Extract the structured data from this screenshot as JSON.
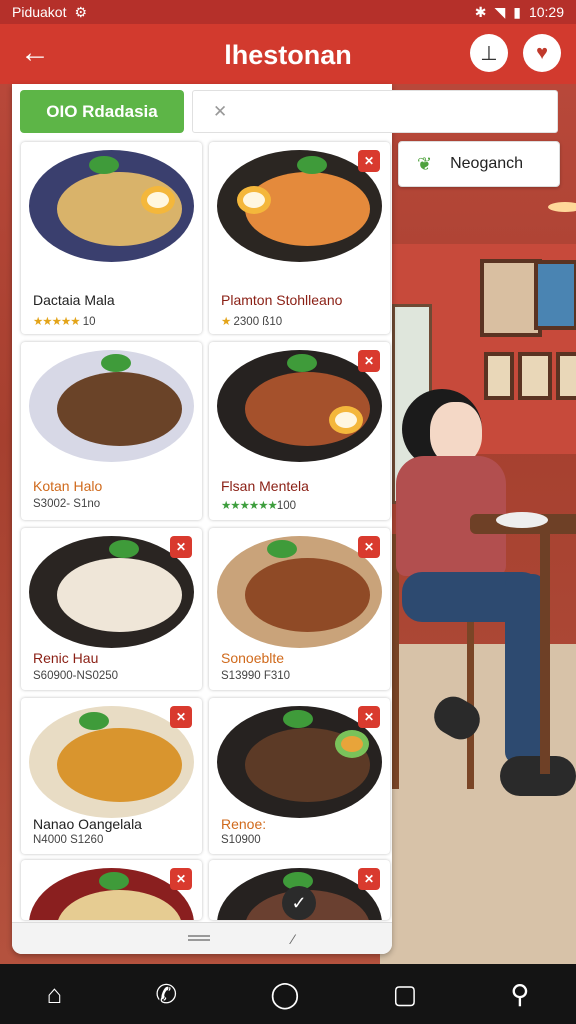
{
  "statusbar": {
    "carrier": "Piduakot",
    "time": "10:29",
    "left_icon": "settings-icon",
    "right_icons": [
      "bluetooth-icon",
      "wifi-icon",
      "battery-icon"
    ]
  },
  "appbar": {
    "title": "lhestonan",
    "back_icon": "arrow-left-icon",
    "action_icons": [
      "info-icon",
      "heart-icon"
    ]
  },
  "search": {
    "chip_label": "OIO Rdadasia",
    "placeholder": ""
  },
  "filter": {
    "label": "Neoganch",
    "icon": "leaf-icon"
  },
  "cards": [
    {
      "name": "Dactaia Mala",
      "stars": "★★★★★",
      "sub": "10",
      "fav": false
    },
    {
      "name": "Plamton Stohlleano",
      "stars": "★",
      "sub": "2300 ß10",
      "fav": true
    },
    {
      "name": "Kotan Halo",
      "stars": "",
      "sub": "S3002- S1no",
      "fav": false
    },
    {
      "name": "Flsan Mentela",
      "stars": "★★★★★★",
      "sub": "100",
      "fav": true
    },
    {
      "name": "Renic Hau",
      "stars": "",
      "sub": "S60900-NS0250",
      "fav": true
    },
    {
      "name": "Sonoeblte",
      "stars": "",
      "sub": "S13990 F310",
      "fav": true
    },
    {
      "name": "Nanao Oangelala",
      "stars": "",
      "sub": "N4000 S1260",
      "fav": true
    },
    {
      "name": "Renoe:",
      "stars": "",
      "sub": "S10900",
      "fav": true
    },
    {
      "name": "",
      "stars": "",
      "sub": "",
      "fav": true
    },
    {
      "name": "",
      "stars": "",
      "sub": "",
      "fav": true
    }
  ],
  "fav_glyph": "✕",
  "navbar": [
    "home-icon",
    "phone-icon",
    "circle-icon",
    "square-icon",
    "profile-icon"
  ],
  "colors": {
    "brand": "#d23a2e",
    "accent_green": "#5db547",
    "nav_bg": "#141414"
  }
}
